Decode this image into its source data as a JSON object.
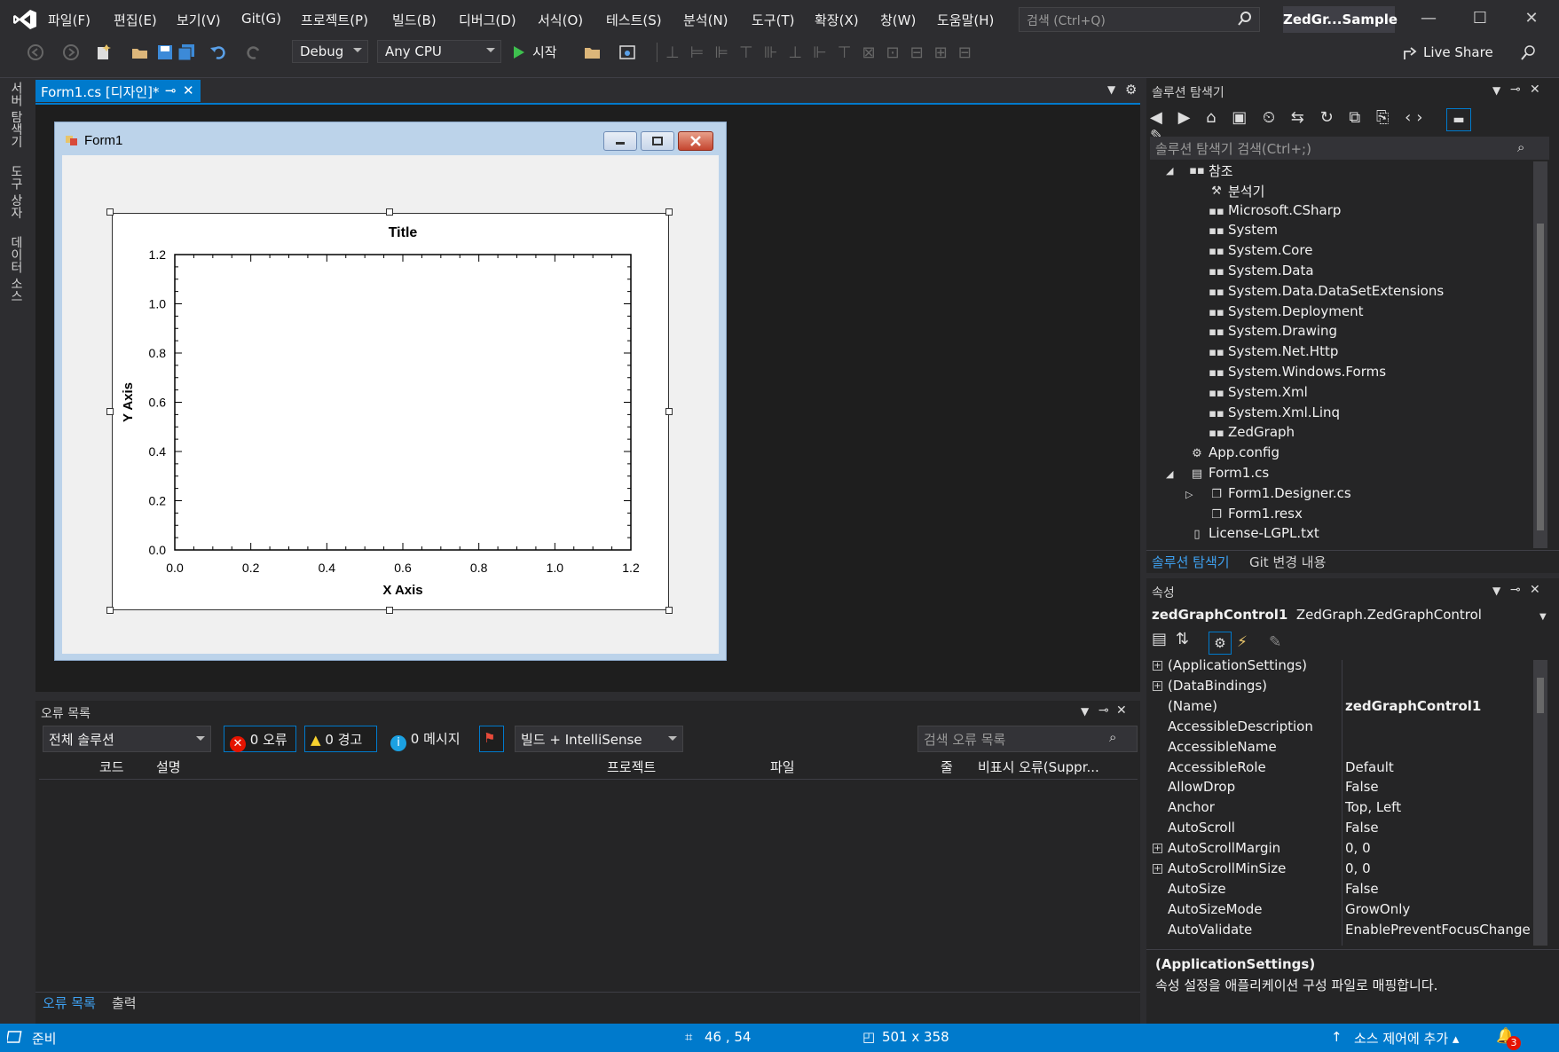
{
  "menu": {
    "items": [
      "파일(F)",
      "편집(E)",
      "보기(V)",
      "Git(G)",
      "프로젝트(P)",
      "빌드(B)",
      "디버그(D)",
      "서식(O)",
      "테스트(S)",
      "분석(N)",
      "도구(T)",
      "확장(X)",
      "창(W)",
      "도움말(H)"
    ],
    "search_placeholder": "검색 (Ctrl+Q)",
    "solution_name": "ZedGr...Sample"
  },
  "toolbar": {
    "config": "Debug",
    "platform": "Any CPU",
    "start_label": "시작",
    "live_share": "Live Share"
  },
  "left_tabs": [
    "서버 탐색기",
    "도구 상자",
    "데이터 소스"
  ],
  "document": {
    "tab_label": "Form1.cs [디자인]*",
    "form_title": "Form1"
  },
  "chart_data": {
    "type": "line",
    "title": "Title",
    "xlabel": "X Axis",
    "ylabel": "Y Axis",
    "xlim": [
      0,
      1.2
    ],
    "ylim": [
      0,
      1.2
    ],
    "x_ticks": [
      "0.0",
      "0.2",
      "0.4",
      "0.6",
      "0.8",
      "1.0",
      "1.2"
    ],
    "y_ticks": [
      "0.0",
      "0.2",
      "0.4",
      "0.6",
      "0.8",
      "1.0",
      "1.2"
    ],
    "series": []
  },
  "error_list": {
    "title": "오류 목록",
    "scope": "전체 솔루션",
    "errors": "0 오류",
    "warnings": "0 경고",
    "messages": "0 메시지",
    "build_filter": "빌드 + IntelliSense",
    "search_placeholder": "검색 오류 목록",
    "columns": [
      "코드",
      "설명",
      "프로젝트",
      "파일",
      "줄",
      "비표시 오류(Suppr..."
    ],
    "bottom_tabs": [
      "오류 목록",
      "출력"
    ]
  },
  "solution_explorer": {
    "title": "솔루션 탐색기",
    "search_placeholder": "솔루션 탐색기 검색(Ctrl+;)",
    "references_label": "참조",
    "references": [
      "분석기",
      "Microsoft.CSharp",
      "System",
      "System.Core",
      "System.Data",
      "System.Data.DataSetExtensions",
      "System.Deployment",
      "System.Drawing",
      "System.Net.Http",
      "System.Windows.Forms",
      "System.Xml",
      "System.Xml.Linq",
      "ZedGraph"
    ],
    "files": [
      "App.config",
      "Form1.cs",
      "Form1.Designer.cs",
      "Form1.resx",
      "License-LGPL.txt"
    ],
    "tabs": [
      "솔루션 탐색기",
      "Git 변경 내용"
    ]
  },
  "properties": {
    "title": "속성",
    "object_name": "zedGraphControl1",
    "object_type": "ZedGraph.ZedGraphControl",
    "rows": [
      {
        "name": "(ApplicationSettings)",
        "value": "",
        "expand": "true"
      },
      {
        "name": "(DataBindings)",
        "value": "",
        "expand": "true"
      },
      {
        "name": "(Name)",
        "value": "zedGraphControl1",
        "expand": "false"
      },
      {
        "name": "AccessibleDescription",
        "value": "",
        "expand": "false"
      },
      {
        "name": "AccessibleName",
        "value": "",
        "expand": "false"
      },
      {
        "name": "AccessibleRole",
        "value": "Default",
        "expand": "false"
      },
      {
        "name": "AllowDrop",
        "value": "False",
        "expand": "false"
      },
      {
        "name": "Anchor",
        "value": "Top, Left",
        "expand": "false"
      },
      {
        "name": "AutoScroll",
        "value": "False",
        "expand": "false"
      },
      {
        "name": "AutoScrollMargin",
        "value": "0, 0",
        "expand": "true"
      },
      {
        "name": "AutoScrollMinSize",
        "value": "0, 0",
        "expand": "true"
      },
      {
        "name": "AutoSize",
        "value": "False",
        "expand": "false"
      },
      {
        "name": "AutoSizeMode",
        "value": "GrowOnly",
        "expand": "false"
      },
      {
        "name": "AutoValidate",
        "value": "EnablePreventFocusChange",
        "expand": "false"
      }
    ],
    "desc_title": "(ApplicationSettings)",
    "desc_text": "속성 설정을 애플리케이션 구성 파일로 매핑합니다."
  },
  "status": {
    "ready": "준비",
    "position": "46 , 54",
    "size": "501 x 358",
    "source_control": "소스 제어에 추가",
    "notifications": "3"
  }
}
